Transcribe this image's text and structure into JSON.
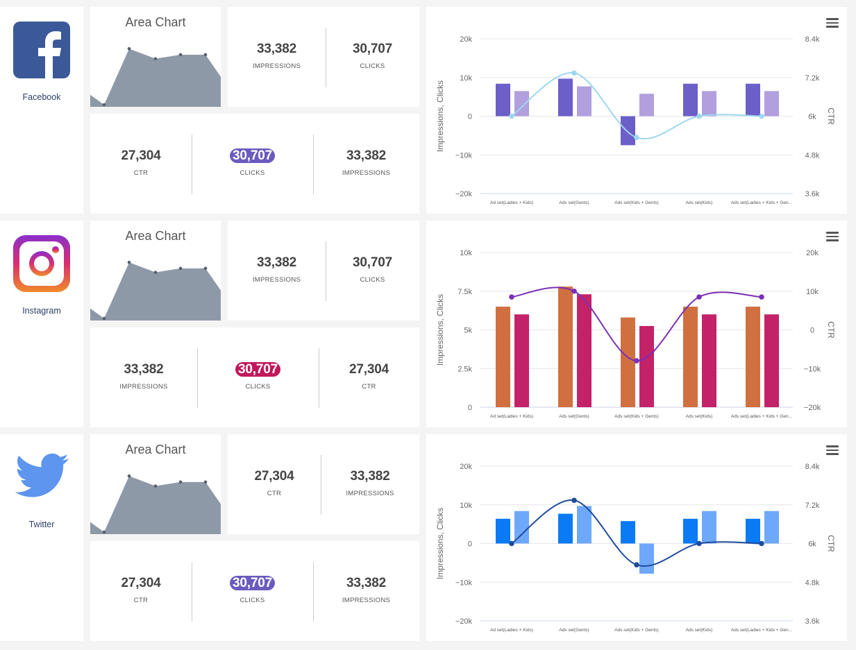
{
  "rows": [
    {
      "platform": "Facebook",
      "logo": "facebook-icon",
      "area_title": "Area Chart",
      "area_values": [
        1,
        0,
        5.6,
        4.6,
        5,
        5,
        2.8
      ],
      "top_stats": [
        {
          "value": "33,382",
          "label": "IMPRESSIONS"
        },
        {
          "value": "30,707",
          "label": "CLICKS"
        }
      ],
      "bottom_stats": [
        {
          "value": "27,304",
          "label": "CTR",
          "highlight": false
        },
        {
          "value": "30,707",
          "label": "CLICKS",
          "highlight": true
        },
        {
          "value": "33,382",
          "label": "IMPRESSIONS",
          "highlight": false
        }
      ],
      "highlight_color": "#6b5bbf",
      "chart_data": {
        "type": "bar",
        "categories": [
          "Ad set(Ladies + Kids)",
          "Ads set(Gents)",
          "Ads set(Kids + Gents)",
          "Ads set(Kids)",
          "Ads set(Ladies + Kids + Gen..."
        ],
        "series": [
          {
            "values": [
              8400,
              9700,
              -7500,
              8400,
              8400
            ],
            "color": "#6c5fc7"
          },
          {
            "values": [
              6500,
              7700,
              5800,
              6500,
              6500
            ],
            "color": "#b19fde"
          }
        ],
        "line": {
          "values": [
            6000,
            7340,
            5340,
            6000,
            6000
          ],
          "color": "#9dd7ef"
        },
        "ylabel": "Impressions, Clicks",
        "y2label": "CTR",
        "y_ticks": [
          "20k",
          "10k",
          "0",
          "−10k",
          "−20k"
        ],
        "y2_ticks": [
          "8.4k",
          "7.2k",
          "6k",
          "4.8k",
          "3.6k"
        ],
        "ylim": [
          -20000,
          20000
        ],
        "y2lim": [
          3600,
          8400
        ]
      }
    },
    {
      "platform": "Instagram",
      "logo": "instagram-icon",
      "area_title": "Area Chart",
      "area_values": [
        1,
        0,
        5.6,
        4.6,
        5,
        5,
        2.8
      ],
      "top_stats": [
        {
          "value": "33,382",
          "label": "IMPRESSIONS"
        },
        {
          "value": "30,707",
          "label": "CLICKS"
        }
      ],
      "bottom_stats": [
        {
          "value": "33,382",
          "label": "IMPRESSIONS",
          "highlight": false
        },
        {
          "value": "30,707",
          "label": "CLICKS",
          "highlight": true
        },
        {
          "value": "27,304",
          "label": "CTR",
          "highlight": false
        }
      ],
      "highlight_color": "#c2185b",
      "chart_data": {
        "type": "bar",
        "categories": [
          "Ad set(Ladies + Kids)",
          "Ads set(Gents)",
          "Ads set(Kids + Gents)",
          "Ads set(Kids)",
          "Ads set(Ladies + Kids + Gen..."
        ],
        "series": [
          {
            "values": [
              6500,
              7800,
              5800,
              6500,
              6500
            ],
            "color": "#d07040"
          },
          {
            "values": [
              6000,
              7300,
              5250,
              6000,
              6000
            ],
            "color": "#c42268"
          }
        ],
        "line": {
          "values": [
            8500,
            10000,
            -8000,
            8500,
            8500
          ],
          "color": "#7b2fb5"
        },
        "ylabel": "Impressions, Clicks",
        "y2label": "CTR",
        "y_ticks": [
          "10k",
          "7.5k",
          "5k",
          "2.5k",
          "0"
        ],
        "y2_ticks": [
          "20k",
          "10k",
          "0",
          "−10k",
          "−20k"
        ],
        "ylim": [
          0,
          10000
        ],
        "y2lim": [
          -20000,
          20000
        ]
      }
    },
    {
      "platform": "Twitter",
      "logo": "twitter-icon",
      "area_title": "Area Chart",
      "area_values": [
        1,
        0,
        5.6,
        4.6,
        5,
        5,
        2.8
      ],
      "top_stats": [
        {
          "value": "27,304",
          "label": "CTR"
        },
        {
          "value": "33,382",
          "label": "IMPRESSIONS"
        }
      ],
      "bottom_stats": [
        {
          "value": "27,304",
          "label": "CTR",
          "highlight": false
        },
        {
          "value": "30,707",
          "label": "CLICKS",
          "highlight": true
        },
        {
          "value": "33,382",
          "label": "IMPRESSIONS",
          "highlight": false
        }
      ],
      "highlight_color": "#6b5bbf",
      "chart_data": {
        "type": "bar",
        "categories": [
          "Ad set(Ladies + Kids)",
          "Ads set(Gents)",
          "Ads set(Kids + Gents)",
          "Ads set(Kids)",
          "Ads set(Ladies + Kids + Gen..."
        ],
        "series": [
          {
            "values": [
              6400,
              7700,
              5800,
              6400,
              6400
            ],
            "color": "#0a7bf5"
          },
          {
            "values": [
              8400,
              9700,
              -7800,
              8400,
              8400
            ],
            "color": "#6ea8fa"
          }
        ],
        "line": {
          "values": [
            6000,
            7340,
            5340,
            6000,
            6000
          ],
          "color": "#1f4b9c"
        },
        "ylabel": "Impressions, Clicks",
        "y2label": "CTR",
        "y_ticks": [
          "20k",
          "10k",
          "0",
          "−10k",
          "−20k"
        ],
        "y2_ticks": [
          "8.4k",
          "7.2k",
          "6k",
          "4.8k",
          "3.6k"
        ],
        "ylim": [
          -20000,
          20000
        ],
        "y2lim": [
          3600,
          8400
        ]
      }
    }
  ]
}
